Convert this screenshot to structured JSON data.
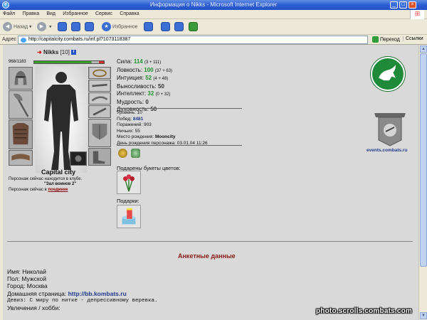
{
  "window": {
    "title": "Информация о Nikks - Microsoft Internet Explorer"
  },
  "menu": [
    "Файл",
    "Правка",
    "Вид",
    "Избранное",
    "Сервис",
    "Справка"
  ],
  "toolbar": {
    "back": "Назад",
    "favorites": "Избранное"
  },
  "address": {
    "label": "Адрес",
    "url": "http://capitalcity.combats.ru/inf.pl?1073118387",
    "go": "Переход",
    "links": "Ссылки"
  },
  "character": {
    "name": "Nikks",
    "level": "[10]",
    "badge": "i",
    "hp": "968/1183",
    "hp_fraction": 0.82,
    "city": "Capital city",
    "location_line1": "Персонаж сейчас находится в клубе.",
    "location_room": "\"Зал воинов 2\"",
    "location_line2_prefix": "Персонаж сейчас в",
    "location_line2_link": "поединке"
  },
  "stats": [
    {
      "label": "Сила:",
      "value": "114",
      "mod": "(3 + 111)",
      "green": true
    },
    {
      "label": "Ловкость:",
      "value": "100",
      "mod": "(37 + 63)",
      "green": true
    },
    {
      "label": "Интуиция:",
      "value": "52",
      "mod": "(4 + 48)",
      "green": true
    },
    {
      "label": "Выносливость:",
      "value": "50",
      "mod": "",
      "green": false
    },
    {
      "label": "Интеллект:",
      "value": "32",
      "mod": "(0 + 32)",
      "green": true
    },
    {
      "label": "Мудрость:",
      "value": "0",
      "mod": "",
      "green": false
    },
    {
      "label": "Духовность:",
      "value": "50",
      "mod": "",
      "green": false
    }
  ],
  "info": {
    "level_label": "Уровень:",
    "level_value": "10",
    "wins_label": "Побед:",
    "wins_value": "8481",
    "losses_label": "Поражений:",
    "losses_value": "903",
    "draws_label": "Ничьих:",
    "draws_value": "55",
    "birthplace_label": "Место рождения:",
    "birthplace_value": "Mooncity",
    "birthday_label": "День рождения персонажа:",
    "birthday_value": "03.01.04 11:26"
  },
  "flowers_label": "Подарены букеты цветов:",
  "gifts_label": "Подарки:",
  "events_link": "events.combats.ru",
  "anketa": {
    "title": "Анкетные данные",
    "name_label": "Имя:",
    "name_value": "Николай",
    "sex_label": "Пол:",
    "sex_value": "Мужской",
    "city_label": "Город:",
    "city_value": "Москва",
    "home_label": "Домашняя страница:",
    "home_value": "http://bb.kombats.ru",
    "motto_label": "Девиз:",
    "motto_value": "С миру по нитке - депрессивному веревка.",
    "hobby_label": "Увлечения / хобби:"
  },
  "watermark": "photo.scrolls.combats.com",
  "colors": {
    "accent_green": "#21932c",
    "link_blue": "#223a8c",
    "title_red": "#8b1a1a",
    "emblem_green": "#1f8a3a"
  }
}
